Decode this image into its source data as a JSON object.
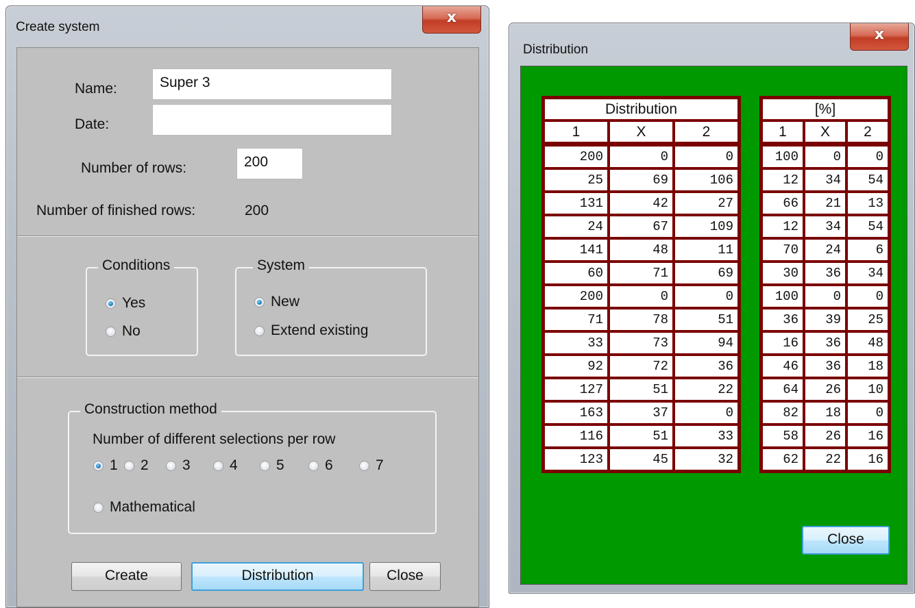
{
  "create_window": {
    "title": "Create system",
    "close_glyph": "x",
    "name_label": "Name:",
    "name_value": "Super 3",
    "date_label": "Date:",
    "date_value": "",
    "rows_label": "Number of rows:",
    "rows_value": "200",
    "finished_label": "Number of finished rows:",
    "finished_value": "200",
    "conditions": {
      "legend": "Conditions",
      "options": [
        "Yes",
        "No"
      ],
      "selected": "Yes"
    },
    "system": {
      "legend": "System",
      "options": [
        "New",
        "Extend existing"
      ],
      "selected": "New"
    },
    "construction": {
      "legend": "Construction method",
      "hint": "Number of different selections per row",
      "options": [
        "1",
        "2",
        "3",
        "4",
        "5",
        "6",
        "7"
      ],
      "mathematical": "Mathematical",
      "selected": "1"
    },
    "buttons": {
      "create": "Create",
      "distribution": "Distribution",
      "close": "Close"
    }
  },
  "distribution_window": {
    "title": "Distribution",
    "close_glyph": "x",
    "counts_header": "Distribution",
    "percent_header": "[%]",
    "columns": [
      "1",
      "X",
      "2"
    ],
    "counts": [
      [
        "200",
        "0",
        "0"
      ],
      [
        "25",
        "69",
        "106"
      ],
      [
        "131",
        "42",
        "27"
      ],
      [
        "24",
        "67",
        "109"
      ],
      [
        "141",
        "48",
        "11"
      ],
      [
        "60",
        "71",
        "69"
      ],
      [
        "200",
        "0",
        "0"
      ],
      [
        "71",
        "78",
        "51"
      ],
      [
        "33",
        "73",
        "94"
      ],
      [
        "92",
        "72",
        "36"
      ],
      [
        "127",
        "51",
        "22"
      ],
      [
        "163",
        "37",
        "0"
      ],
      [
        "116",
        "51",
        "33"
      ],
      [
        "123",
        "45",
        "32"
      ]
    ],
    "percents": [
      [
        "100",
        "0",
        "0"
      ],
      [
        "12",
        "34",
        "54"
      ],
      [
        "66",
        "21",
        "13"
      ],
      [
        "12",
        "34",
        "54"
      ],
      [
        "70",
        "24",
        "6"
      ],
      [
        "30",
        "36",
        "34"
      ],
      [
        "100",
        "0",
        "0"
      ],
      [
        "36",
        "39",
        "25"
      ],
      [
        "16",
        "36",
        "48"
      ],
      [
        "46",
        "36",
        "18"
      ],
      [
        "64",
        "26",
        "10"
      ],
      [
        "82",
        "18",
        "0"
      ],
      [
        "58",
        "26",
        "16"
      ],
      [
        "62",
        "22",
        "16"
      ]
    ],
    "close_button": "Close",
    "colors": {
      "background": "#009900",
      "grid": "#7a0000"
    }
  }
}
